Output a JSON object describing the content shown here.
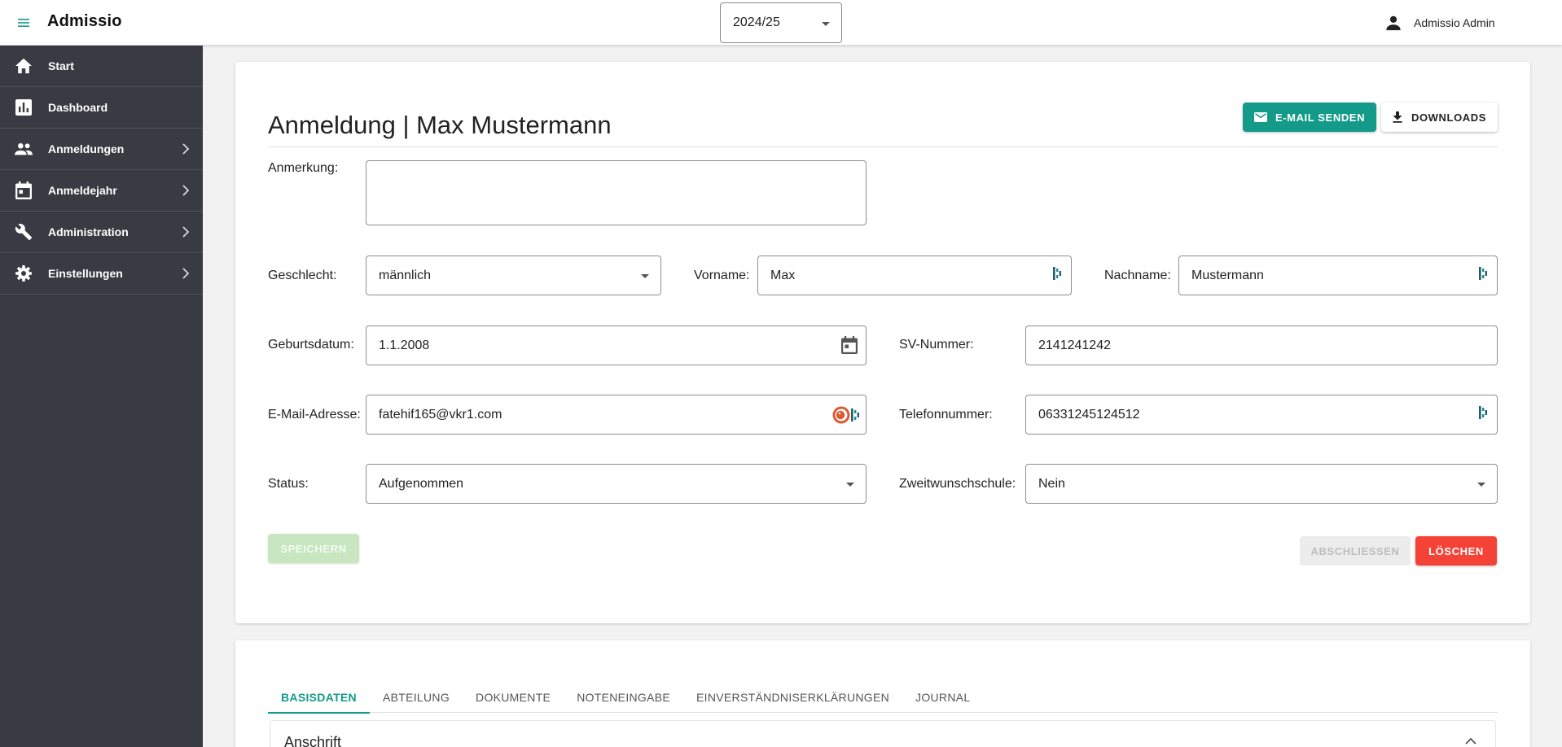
{
  "app": {
    "title": "Admissio"
  },
  "header": {
    "year_value": "2024/25",
    "user_name": "Admissio Admin"
  },
  "sidebar": {
    "items": [
      {
        "label": "Start",
        "icon": "home-icon",
        "has_submenu": false
      },
      {
        "label": "Dashboard",
        "icon": "bar-chart-icon",
        "has_submenu": false
      },
      {
        "label": "Anmeldungen",
        "icon": "people-icon",
        "has_submenu": true
      },
      {
        "label": "Anmeldejahr",
        "icon": "calendar-icon",
        "has_submenu": true
      },
      {
        "label": "Administration",
        "icon": "wrench-icon",
        "has_submenu": true
      },
      {
        "label": "Einstellungen",
        "icon": "gear-icon",
        "has_submenu": true
      }
    ]
  },
  "form": {
    "title": "Anmeldung | Max Mustermann",
    "email_button": "E-MAIL SENDEN",
    "downloads_button": "DOWNLOADS",
    "remark_label": "Anmerkung:",
    "remark_value": "",
    "gender_label": "Geschlecht:",
    "gender_value": "männlich",
    "firstname_label": "Vorname:",
    "firstname_value": "Max",
    "lastname_label": "Nachname:",
    "lastname_value": "Mustermann",
    "birthdate_label": "Geburtsdatum:",
    "birthdate_value": "1.1.2008",
    "ssn_label": "SV-Nummer:",
    "ssn_value": "2141241242",
    "email_label": "E-Mail-Adresse:",
    "email_value": "fatehif165@vkr1.com",
    "phone_label": "Telefonnummer:",
    "phone_value": "06331245124512",
    "status_label": "Status:",
    "status_value": "Aufgenommen",
    "second_choice_label": "Zweitwunschschule:",
    "second_choice_value": "Nein",
    "save_button": "SPEICHERN",
    "finish_button": "ABSCHLIESSEN",
    "delete_button": "LÖSCHEN"
  },
  "tabs": [
    {
      "label": "BASISDATEN",
      "active": true
    },
    {
      "label": "ABTEILUNG",
      "active": false
    },
    {
      "label": "DOKUMENTE",
      "active": false
    },
    {
      "label": "NOTENEINGABE",
      "active": false
    },
    {
      "label": "EINVERSTÄNDNISERKLÄRUNGEN",
      "active": false
    },
    {
      "label": "JOURNAL",
      "active": false
    }
  ],
  "section": {
    "label": "Anschrift"
  },
  "colors": {
    "accent": "#149a89",
    "danger": "#f44336",
    "sidebar": "#3a3a42",
    "save_disabled": "#c8e6c0"
  }
}
